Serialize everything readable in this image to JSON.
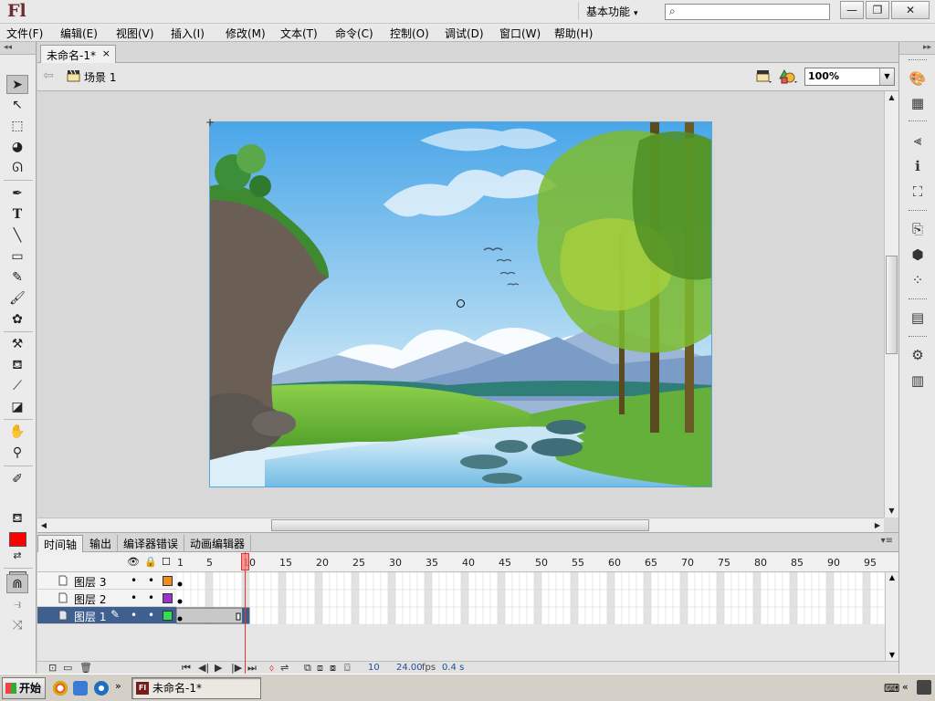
{
  "app": {
    "logo": "Fl"
  },
  "window": {
    "workspace": "基本功能",
    "search_placeholder": "",
    "min_label": "—",
    "max_label": "❐",
    "close_label": "✕"
  },
  "menu": [
    {
      "label": "文件(F)"
    },
    {
      "label": "编辑(E)"
    },
    {
      "label": "视图(V)"
    },
    {
      "label": "插入(I)"
    },
    {
      "label": "修改(M)"
    },
    {
      "label": "文本(T)"
    },
    {
      "label": "命令(C)"
    },
    {
      "label": "控制(O)"
    },
    {
      "label": "调试(D)"
    },
    {
      "label": "窗口(W)"
    },
    {
      "label": "帮助(H)"
    }
  ],
  "document": {
    "tab_title": "未命名-1*",
    "tab_close": "×",
    "scene_label": "场景 1",
    "zoom": "100%"
  },
  "tools": {
    "fill_color": "#ff0000"
  },
  "timeline": {
    "tabs": [
      "时间轴",
      "输出",
      "编译器错误",
      "动画编辑器"
    ],
    "frame_numbers": [
      "1",
      "5",
      "10",
      "15",
      "20",
      "25",
      "30",
      "35",
      "40",
      "45",
      "50",
      "55",
      "60",
      "65",
      "70",
      "75",
      "80",
      "85",
      "90",
      "95"
    ],
    "current_frame_marker": "10",
    "layers": [
      {
        "name": "图层 3",
        "color": "#f08a1c",
        "selected": false
      },
      {
        "name": "图层 2",
        "color": "#9933cc",
        "selected": false
      },
      {
        "name": "图层 1",
        "color": "#33dd55",
        "selected": true
      }
    ],
    "status": {
      "current_frame": "10",
      "fps": "24.00",
      "fps_unit": "fps",
      "elapsed": "0.4 s"
    }
  },
  "taskbar": {
    "start_label": "开始",
    "task_label": "未命名-1*",
    "quick_more": "»",
    "tray_more": "«"
  }
}
